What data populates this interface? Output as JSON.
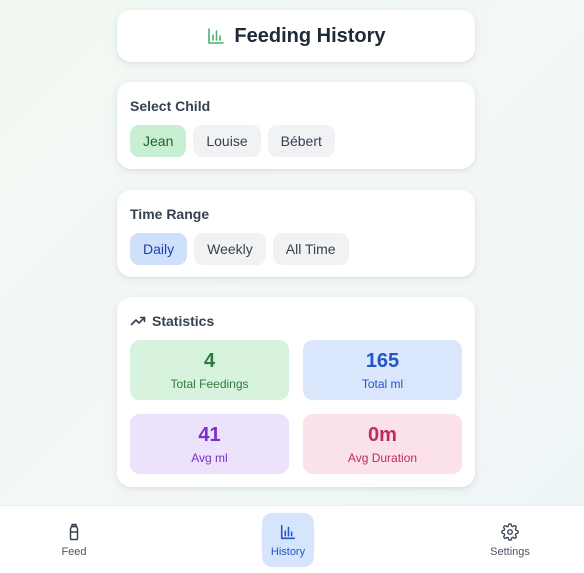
{
  "header": {
    "title": "Feeding History",
    "icon": "bar-chart-icon"
  },
  "select_child": {
    "label": "Select Child",
    "children": [
      "Jean",
      "Louise",
      "Bébert"
    ],
    "selected": "Jean"
  },
  "time_range": {
    "label": "Time Range",
    "options": [
      "Daily",
      "Weekly",
      "All Time"
    ],
    "selected": "Daily"
  },
  "statistics": {
    "label": "Statistics",
    "icon": "trending-up-icon",
    "items": [
      {
        "value": "4",
        "label": "Total Feedings",
        "color": "#2f7a3d"
      },
      {
        "value": "165",
        "label": "Total ml",
        "color": "#2554c7"
      },
      {
        "value": "41",
        "label": "Avg ml",
        "color": "#7c2fc9"
      },
      {
        "value": "0m",
        "label": "Avg Duration",
        "color": "#c12b5f"
      }
    ]
  },
  "nav": {
    "items": [
      {
        "label": "Feed",
        "icon": "bottle-icon"
      },
      {
        "label": "History",
        "icon": "bar-chart-icon",
        "active": true
      },
      {
        "label": "Settings",
        "icon": "gear-icon"
      }
    ]
  },
  "colors": {
    "accent_green": "#c8efd2",
    "accent_blue": "#cfe0fb"
  }
}
